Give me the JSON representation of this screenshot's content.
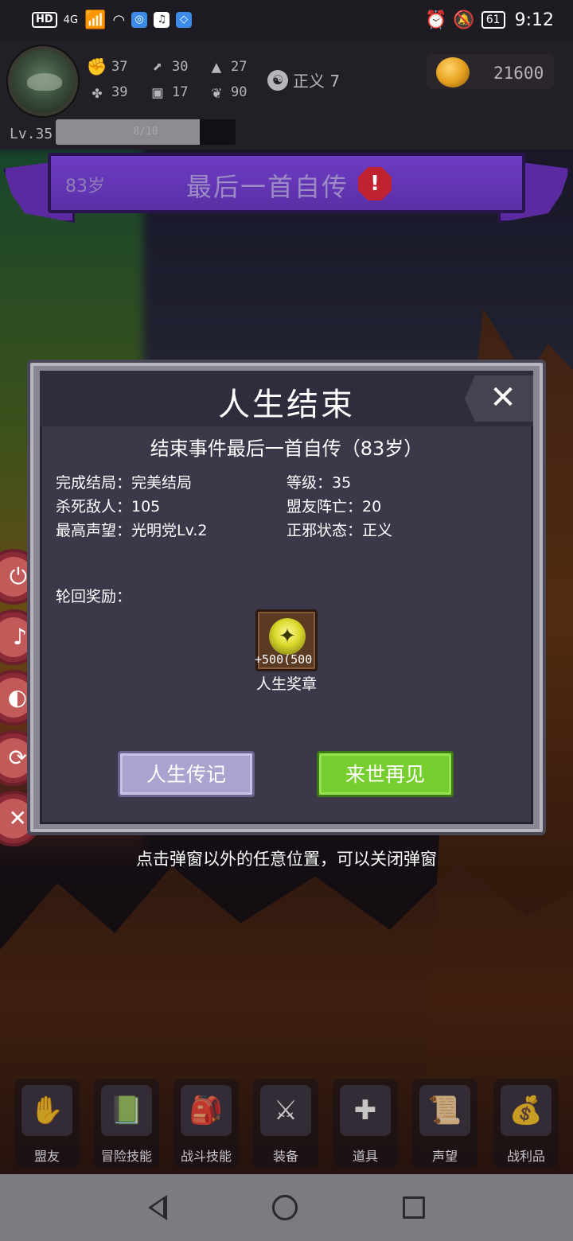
{
  "status_bar": {
    "hd": "HD",
    "network": "4G",
    "battery": "61",
    "time": "9:12"
  },
  "hud": {
    "stats": [
      {
        "icon": "fist-icon",
        "value": "37"
      },
      {
        "icon": "boot-icon",
        "value": "30"
      },
      {
        "icon": "wizard-hat-icon",
        "value": "27"
      },
      {
        "icon": "clover-icon",
        "value": "39"
      },
      {
        "icon": "armor-icon",
        "value": "17"
      },
      {
        "icon": "leaf-icon",
        "value": "90"
      }
    ],
    "alignment_label": "正义 7",
    "gold": "21600",
    "level": "Lv.35",
    "xp_text": "8/10",
    "xp_fraction": 0.8
  },
  "ribbon": {
    "age": "83岁",
    "title": "最后一首自传",
    "alert_symbol": "!"
  },
  "modal": {
    "title": "人生结束",
    "close_symbol": "✕",
    "event_line": "结束事件最后一首自传（83岁）",
    "left_stats": [
      "完成结局：完美结局",
      "杀死敌人：105",
      "最高声望：光明党Lv.2"
    ],
    "right_stats": [
      "等级：35",
      "盟友阵亡：20",
      "正邪状态：正义"
    ],
    "rewards_label": "轮回奖励：",
    "reward": {
      "icon": "medal-icon",
      "quantity": "+500(500",
      "name": "人生奖章"
    },
    "buttons": {
      "biography": "人生传记",
      "next_life": "来世再见"
    }
  },
  "hint": "点击弹窗以外的任意位置，可以关闭弹窗",
  "tabs": [
    {
      "label": "盟友",
      "icon": "glove-icon",
      "glyph": "✋"
    },
    {
      "label": "冒险技能",
      "icon": "book-icon",
      "glyph": "📗"
    },
    {
      "label": "战斗技能",
      "icon": "backpack-icon",
      "glyph": "🎒"
    },
    {
      "label": "装备",
      "icon": "crossed-swords-icon",
      "glyph": "⚔"
    },
    {
      "label": "道具",
      "icon": "satchel-icon",
      "glyph": "✚"
    },
    {
      "label": "声望",
      "icon": "scroll-icon",
      "glyph": "📜"
    },
    {
      "label": "战利品",
      "icon": "treasure-chest-icon",
      "glyph": "💰"
    }
  ],
  "side_buttons": [
    "⏻",
    "♪",
    "◐",
    "⟳",
    "✕"
  ]
}
